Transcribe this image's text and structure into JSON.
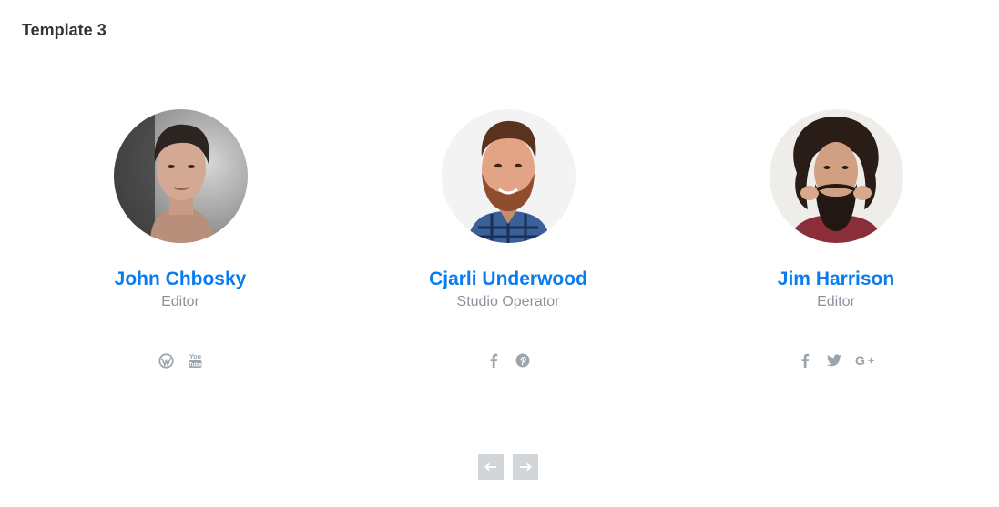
{
  "section": {
    "title": "Template 3"
  },
  "members": [
    {
      "name": "John Chbosky",
      "role": "Editor",
      "socials": [
        "wordpress-icon",
        "youtube-icon"
      ]
    },
    {
      "name": "Cjarli Underwood",
      "role": "Studio Operator",
      "socials": [
        "facebook-icon",
        "pinterest-icon"
      ]
    },
    {
      "name": "Jim Harrison",
      "role": "Editor",
      "socials": [
        "facebook-icon",
        "twitter-icon",
        "google-plus-icon"
      ]
    }
  ],
  "colors": {
    "name": "#0a7cf0",
    "role": "#8a939c",
    "icon": "#9aa5ad",
    "nav_button": "#d3d6d9"
  },
  "nav": {
    "prev_icon": "arrow-left-icon",
    "next_icon": "arrow-right-icon"
  }
}
